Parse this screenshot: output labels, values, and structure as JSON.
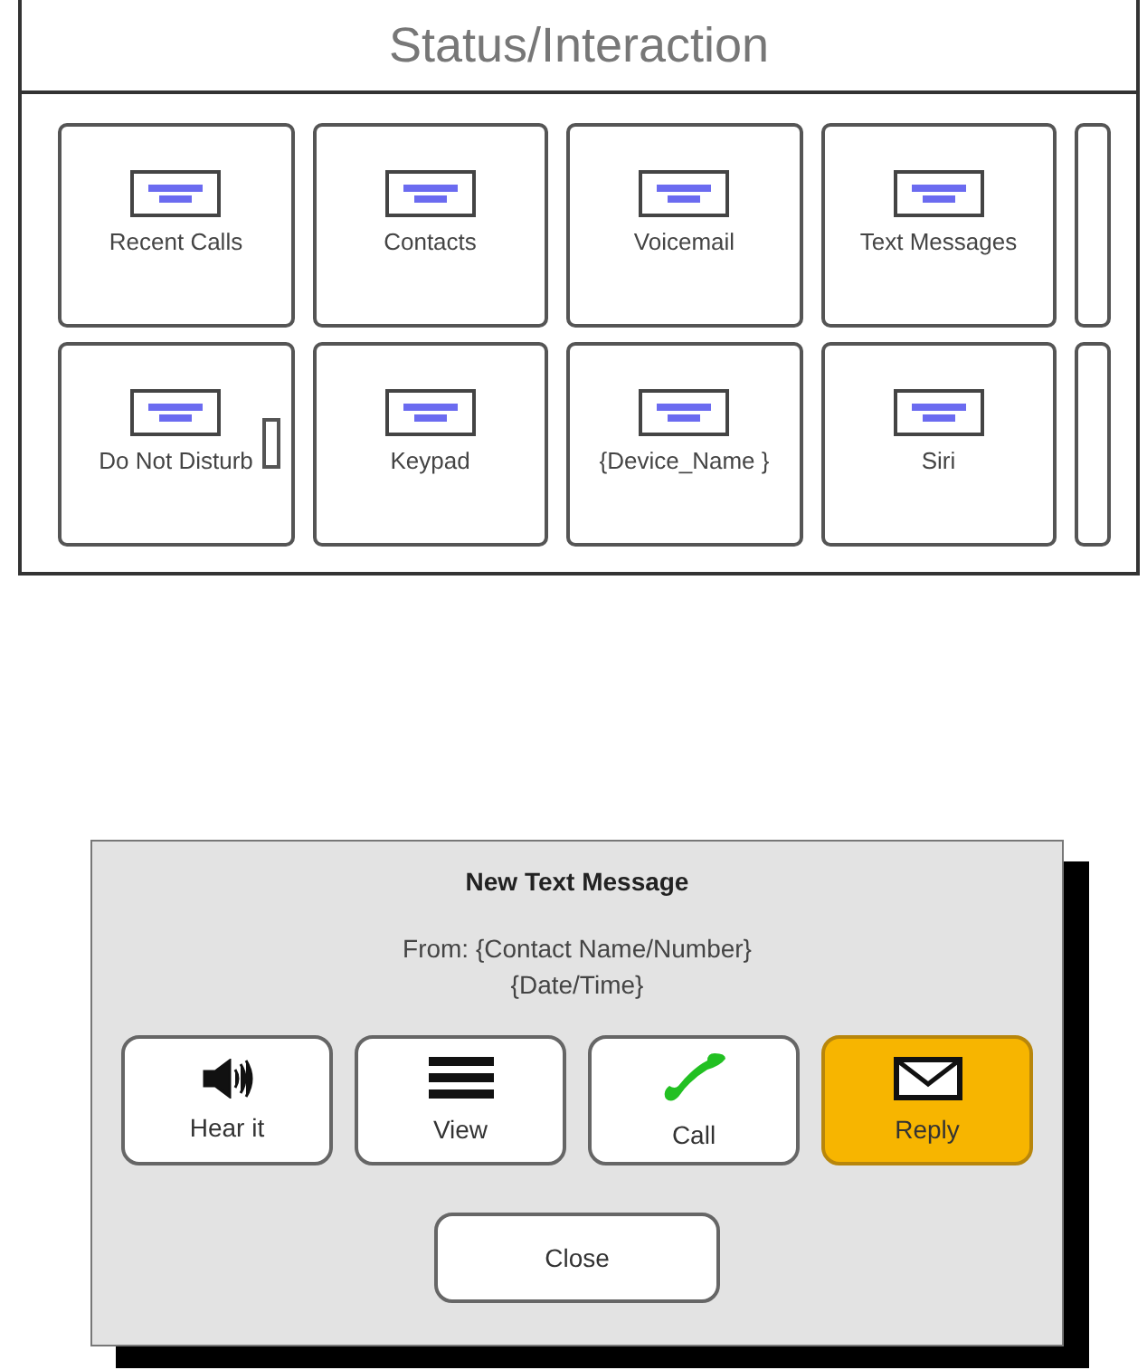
{
  "panel": {
    "title": "Status/Interaction",
    "tiles": [
      {
        "label": "Recent Calls",
        "marker": false
      },
      {
        "label": "Contacts",
        "marker": false
      },
      {
        "label": "Voicemail",
        "marker": false
      },
      {
        "label": "Text Messages",
        "marker": false
      },
      {
        "label": "Do Not Disturb",
        "marker": true
      },
      {
        "label": "Keypad",
        "marker": false
      },
      {
        "label": "{Device_Name }",
        "marker": false
      },
      {
        "label": "Siri",
        "marker": false
      }
    ]
  },
  "dialog": {
    "title": "New Text Message",
    "from": "From: {Contact Name/Number}",
    "date": "{Date/Time}",
    "actions": [
      {
        "label": "Hear it",
        "selected": false
      },
      {
        "label": "View",
        "selected": false
      },
      {
        "label": "Call",
        "selected": false
      },
      {
        "label": "Reply",
        "selected": true
      }
    ],
    "close": "Close"
  }
}
